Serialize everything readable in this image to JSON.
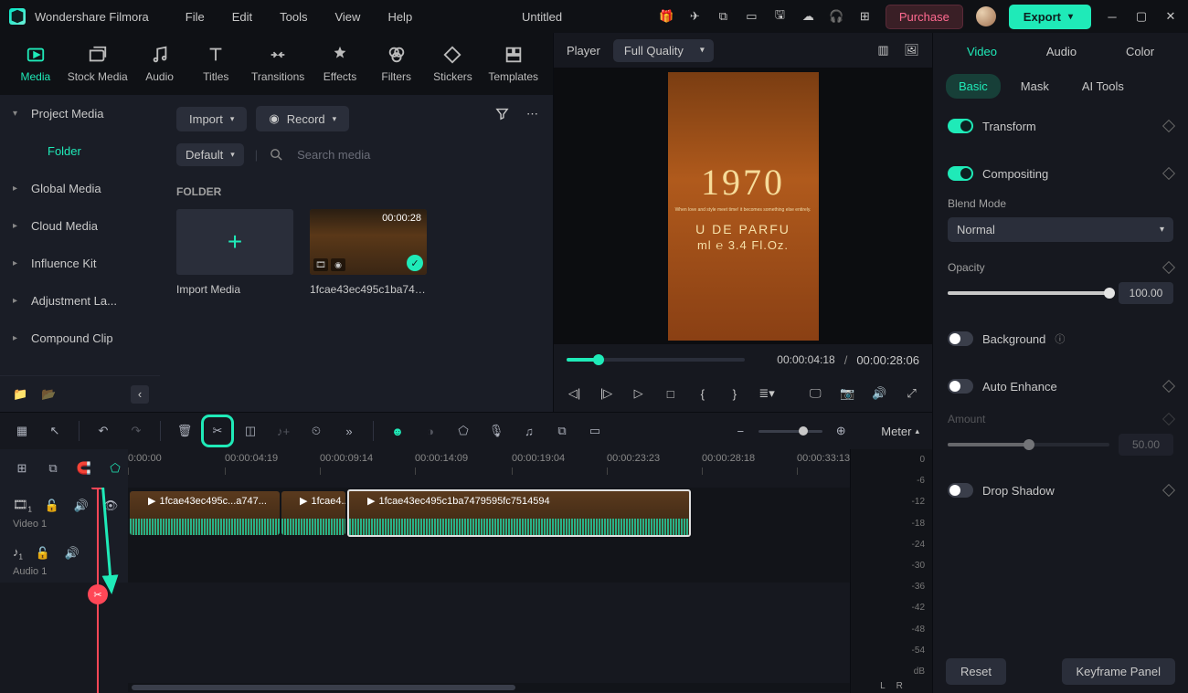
{
  "app": {
    "title": "Wondershare Filmora",
    "project_title": "Untitled"
  },
  "menu": [
    "File",
    "Edit",
    "Tools",
    "View",
    "Help"
  ],
  "titlebar": {
    "purchase": "Purchase",
    "export": "Export"
  },
  "top_tabs": [
    {
      "label": "Media",
      "active": true
    },
    {
      "label": "Stock Media"
    },
    {
      "label": "Audio"
    },
    {
      "label": "Titles"
    },
    {
      "label": "Transitions"
    },
    {
      "label": "Effects"
    },
    {
      "label": "Filters"
    },
    {
      "label": "Stickers"
    },
    {
      "label": "Templates"
    }
  ],
  "sidebar": {
    "items": [
      {
        "label": "Project Media",
        "active": false,
        "level": 1
      },
      {
        "label": "Folder",
        "active": true,
        "level": 2
      },
      {
        "label": "Global Media",
        "level": 1
      },
      {
        "label": "Cloud Media",
        "level": 1
      },
      {
        "label": "Influence Kit",
        "level": 1
      },
      {
        "label": "Adjustment La...",
        "level": 1
      },
      {
        "label": "Compound Clip",
        "level": 1
      }
    ]
  },
  "media": {
    "import": "Import",
    "record": "Record",
    "sort": "Default",
    "search_placeholder": "Search media",
    "section": "FOLDER",
    "import_media": "Import Media",
    "clip_name": "1fcae43ec495c1ba747...",
    "clip_duration": "00:00:28"
  },
  "player": {
    "label": "Player",
    "quality": "Full Quality",
    "preview": {
      "year": "1970",
      "sub": "When love and style meet time!\nit becomes something else entirely.",
      "line1": "U  DE  PARFU",
      "line2": "ml ℮ 3.4 Fl.Oz."
    },
    "current": "00:00:04:18",
    "sep": "/",
    "total": "00:00:28:06"
  },
  "props": {
    "tabs": [
      "Video",
      "Audio",
      "Color"
    ],
    "subtabs": [
      "Basic",
      "Mask",
      "AI Tools"
    ],
    "transform": "Transform",
    "compositing": "Compositing",
    "blend_mode_label": "Blend Mode",
    "blend_mode": "Normal",
    "opacity_label": "Opacity",
    "opacity": "100.00",
    "background": "Background",
    "auto_enhance": "Auto Enhance",
    "amount_label": "Amount",
    "amount": "50.00",
    "drop_shadow": "Drop Shadow",
    "reset": "Reset",
    "keyframe_panel": "Keyframe Panel"
  },
  "timeline": {
    "meter": "Meter",
    "playhead_tc": "00:00:04:19",
    "ticks": [
      "0:00:00",
      "00:00:04:19",
      "00:00:09:14",
      "00:00:14:09",
      "00:00:19:04",
      "00:00:23:23",
      "00:00:28:18",
      "00:00:33:13"
    ],
    "tick_positions": [
      0,
      106,
      210,
      314,
      420,
      524,
      628,
      732
    ],
    "tracks": {
      "video": "Video 1",
      "audio": "Audio 1"
    },
    "clip1": "1fcae43ec495c...a747...",
    "clip1b": "1fcae4...",
    "clip2": "1fcae43ec495c1ba7479595fc7514594",
    "meter_scale": [
      "0",
      "-6",
      "-12",
      "-18",
      "-24",
      "-30",
      "-36",
      "-42",
      "-48",
      "-54",
      "dB"
    ],
    "meter_lr": [
      "L",
      "R"
    ]
  }
}
